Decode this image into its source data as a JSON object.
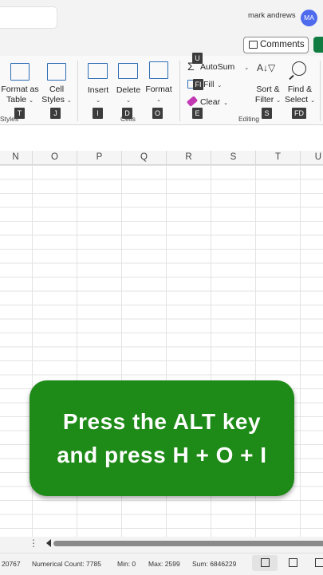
{
  "titlebar": {
    "user_name": "mark andrews",
    "avatar_initials": "MA"
  },
  "comments": {
    "label": "Comments"
  },
  "ribbon": {
    "styles": {
      "format_as_table_l1": "Format as",
      "format_as_table_l2": "Table",
      "cell_styles_l1": "Cell",
      "cell_styles_l2": "Styles",
      "group_label": "Styles",
      "key_t": "T",
      "key_j": "J"
    },
    "cells": {
      "insert": "Insert",
      "delete": "Delete",
      "format": "Format",
      "group_label": "Cells",
      "key_i": "I",
      "key_d": "D",
      "key_o": "O"
    },
    "editing": {
      "autosum": "AutoSum",
      "fill": "Fill",
      "clear": "Clear",
      "sort_filter_l1": "Sort &",
      "sort_filter_l2": "Filter",
      "find_select_l1": "Find &",
      "find_select_l2": "Select",
      "group_label": "Editing",
      "key_u": "U",
      "key_fi": "FI",
      "key_e": "E",
      "key_s": "S",
      "key_fd": "FD"
    }
  },
  "columns": [
    "N",
    "O",
    "P",
    "Q",
    "R",
    "S",
    "T",
    "U"
  ],
  "callout": {
    "line1": "Press the ALT key",
    "line2": "and press H + O + I"
  },
  "statusbar": {
    "sum_partial": "20767",
    "numerical_count": "Numerical Count: 7785",
    "min": "Min: 0",
    "max": "Max: 2599",
    "sum": "Sum: 6846229"
  },
  "colors": {
    "accent_green": "#1e8a17",
    "excel_green": "#107c41",
    "avatar_blue": "#4f6bed"
  }
}
